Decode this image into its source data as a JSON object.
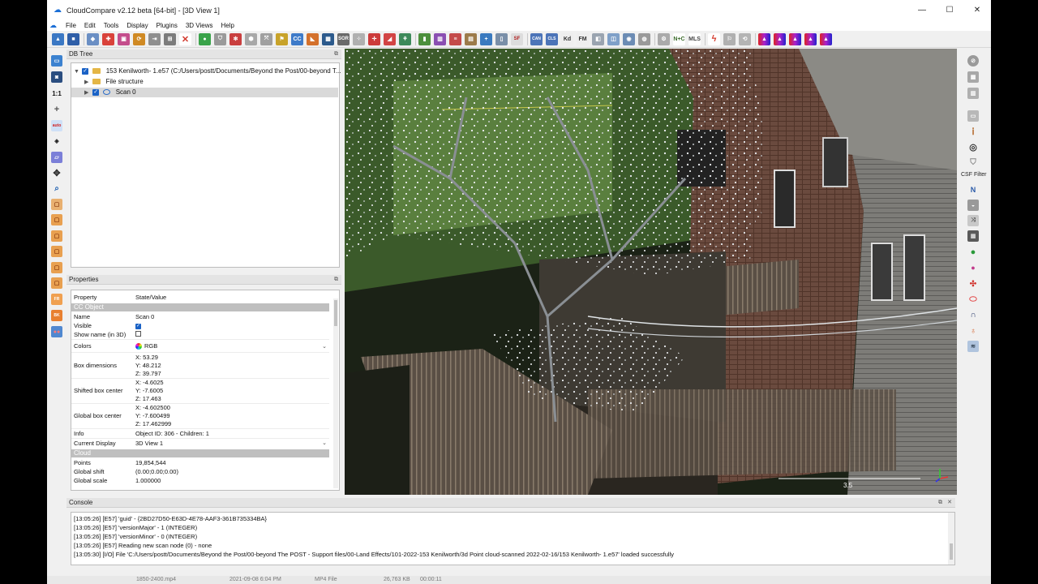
{
  "window": {
    "title": "CloudCompare v2.12 beta [64-bit] - [3D View 1]"
  },
  "window_controls": {
    "minimize": "—",
    "maximize": "☐",
    "close": "✕"
  },
  "menu": [
    "File",
    "Edit",
    "Tools",
    "Display",
    "Plugins",
    "3D Views",
    "Help"
  ],
  "toolbar": {
    "sor_label": "SOR",
    "kd_label": "Kd",
    "fm_label": "FM",
    "nc_label": "N+C",
    "mls_label": "MLS",
    "sf_label": "SF"
  },
  "left_toolbar": {
    "scale_label": "1:1",
    "auto_label": "auto"
  },
  "db_tree": {
    "title": "DB Tree",
    "items": [
      {
        "label": "153 Kenilworth- 1.e57 (C:/Users/postt/Documents/Beyond the Post/00-beyond T..."
      },
      {
        "label": "File structure"
      },
      {
        "label": "Scan 0"
      }
    ]
  },
  "properties": {
    "title": "Properties",
    "header": {
      "property": "Property",
      "value": "State/Value"
    },
    "section_cc_object": "CC Object",
    "name": {
      "key": "Name",
      "value": "Scan 0"
    },
    "visible": {
      "key": "Visible"
    },
    "show_name": {
      "key": "Show name (in 3D)"
    },
    "colors": {
      "key": "Colors",
      "value": "RGB"
    },
    "box_dimensions": {
      "key": "Box dimensions",
      "x": "X: 53.29",
      "y": "Y: 48.212",
      "z": "Z: 39.797"
    },
    "shifted_box_center": {
      "key": "Shifted box center",
      "x": "X: -4.6025",
      "y": "Y: -7.6005",
      "z": "Z: 17.463"
    },
    "global_box_center": {
      "key": "Global box center",
      "x": "X: -4.602500",
      "y": "Y: -7.600499",
      "z": "Z: 17.462999"
    },
    "info": {
      "key": "Info",
      "value": "Object ID: 306 - Children: 1"
    },
    "current_display": {
      "key": "Current Display",
      "value": "3D View 1"
    },
    "section_cloud": "Cloud",
    "points": {
      "key": "Points",
      "value": "19,854,544"
    },
    "global_shift": {
      "key": "Global shift",
      "value": "(0.00;0.00;0.00)"
    },
    "global_scale": {
      "key": "Global scale",
      "value": "1.000000"
    }
  },
  "view3d": {
    "scale_label": "3.5"
  },
  "right_toolbar": {
    "csf_label": "CSF Filter"
  },
  "console": {
    "title": "Console",
    "lines": [
      "[13:05:26] [E57] 'guid' - {2BD27D50-E63D-4E78-AAF3-361B735334BA}",
      "[13:05:26] [E57] 'versionMajor' - 1 (INTEGER)",
      "[13:05:26] [E57] 'versionMinor' - 0 (INTEGER)",
      "[13:05:26] [E57] Reading new scan node (0) - none",
      "[13:05:30] [I/O] File 'C:/Users/postt/Documents/Beyond the Post/00-beyond The POST - Support files/00-Land Effects/101-2022-153 Kenilworth/3d Point cloud-scanned 2022-02-16/153 Kenilworth- 1.e57' loaded successfully"
    ]
  },
  "taskbar_remnant": {
    "file": "1850-2400.mp4",
    "date": "2021-09-08 6:04 PM",
    "type": "MP4 File",
    "size": "26,763 KB",
    "duration": "00:00:11"
  },
  "colors": {
    "accent": "#1a62c6",
    "section_bg": "#bfbfbf",
    "folder": "#e4b646"
  }
}
